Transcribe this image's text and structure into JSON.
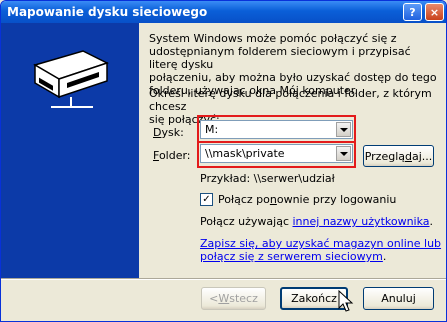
{
  "window": {
    "title": "Mapowanie dysku sieciowego",
    "help_glyph": "?",
    "close_glyph": "×"
  },
  "description": {
    "line1": "System Windows może pomóc połączyć się z",
    "line2": "udostępnianym folderem sieciowym i przypisać literę dysku",
    "line3": "połączeniu, aby można było uzyskać dostęp do tego",
    "line4": "folderu, używając okna Mój komputer.",
    "line5": "Określ literę dysku dla połączenia i folder, z którym chcesz",
    "line6": "się połączyć:"
  },
  "drive": {
    "label_accel": "D",
    "label_rest": "ysk:",
    "value": "M:"
  },
  "folder": {
    "label_accel": "F",
    "label_rest": "older:",
    "value": "\\\\mask\\private"
  },
  "browse_button": {
    "pre": "Przeglą",
    "accel": "d",
    "post": "aj..."
  },
  "example": "Przykład: \\\\serwer\\udział",
  "reconnect": {
    "pre": "Połącz po",
    "accel": "n",
    "post": "ownie przy logowaniu",
    "checked": true,
    "check_glyph": "✓"
  },
  "connect_as": {
    "pre": "Połącz używając ",
    "link": "innej nazwy użytkownika",
    "post": "."
  },
  "signup": {
    "line1": "Zapisz się, aby uzyskać magazyn online lub",
    "line2": "połącz się z serwerem sieciowym",
    "post": "."
  },
  "buttons": {
    "back": {
      "pre": "< ",
      "accel": "W",
      "post": "stecz"
    },
    "finish": "Zakończ",
    "cancel": "Anuluj"
  }
}
